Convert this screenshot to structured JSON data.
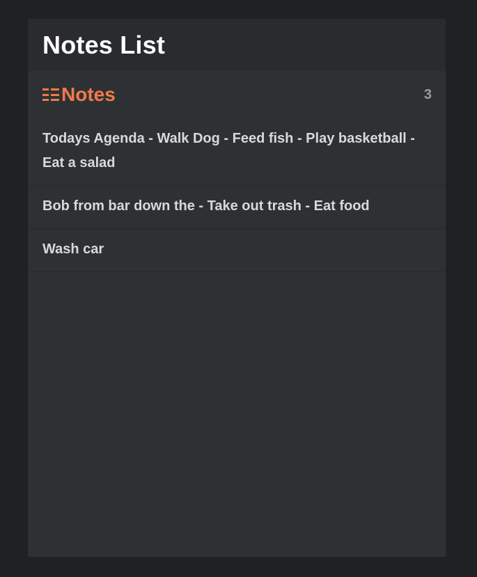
{
  "header": {
    "title": "Notes List"
  },
  "section": {
    "title": "Notes",
    "icon": "list-icon",
    "count": "3",
    "accent_color": "#f07a4a"
  },
  "notes": [
    {
      "text": "Todays Agenda - Walk Dog - Feed fish - Play basketball - Eat a salad"
    },
    {
      "text": "Bob from bar down the - Take out trash - Eat food"
    },
    {
      "text": "Wash car"
    }
  ]
}
